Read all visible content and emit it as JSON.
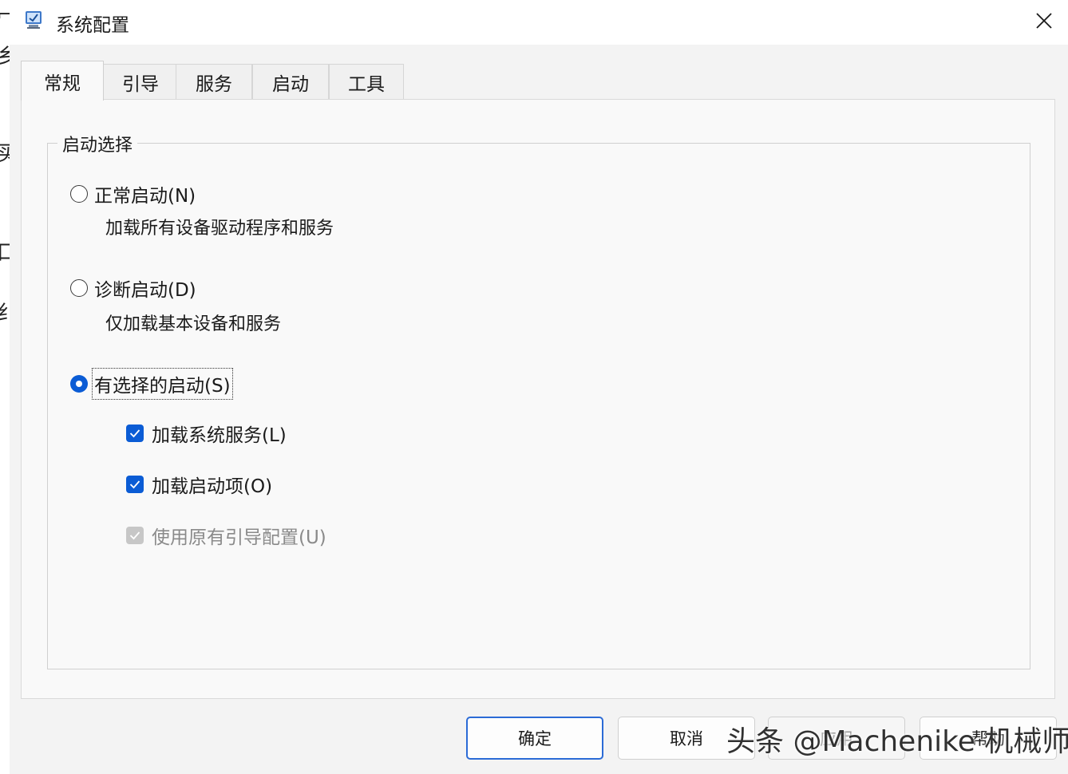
{
  "window": {
    "title": "系统配置",
    "accent_color": "#0b5cd5"
  },
  "background_fragments": [
    "冖",
    "乡",
    "买",
    "口",
    "纟"
  ],
  "tabs": [
    {
      "label": "常规",
      "active": true
    },
    {
      "label": "引导",
      "active": false
    },
    {
      "label": "服务",
      "active": false
    },
    {
      "label": "启动",
      "active": false
    },
    {
      "label": "工具",
      "active": false
    }
  ],
  "startup_group": {
    "legend": "启动选择",
    "options": [
      {
        "label": "正常启动(N)",
        "description": "加载所有设备驱动程序和服务",
        "selected": false
      },
      {
        "label": "诊断启动(D)",
        "description": "仅加载基本设备和服务",
        "selected": false
      },
      {
        "label": "有选择的启动(S)",
        "selected": true
      }
    ],
    "checkboxes": [
      {
        "label": "加载系统服务(L)",
        "checked": true,
        "disabled": false
      },
      {
        "label": "加载启动项(O)",
        "checked": true,
        "disabled": false
      },
      {
        "label": "使用原有引导配置(U)",
        "checked": true,
        "disabled": true
      }
    ]
  },
  "buttons": {
    "ok": "确定",
    "cancel": "取消",
    "apply": "应用",
    "help": "帮助"
  },
  "watermark": "头条 @Machenike 机械师"
}
